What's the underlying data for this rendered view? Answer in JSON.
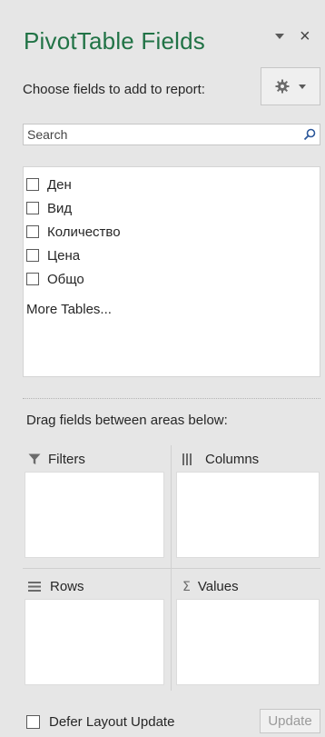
{
  "panel": {
    "title": "PivotTable Fields",
    "close_glyph": "×",
    "choose_label": "Choose fields to add to report:",
    "tools_icon": "gear-icon"
  },
  "search": {
    "placeholder": "Search",
    "icon": "search-icon"
  },
  "fields": [
    {
      "label": "Ден",
      "checked": false
    },
    {
      "label": "Вид",
      "checked": false
    },
    {
      "label": "Количество",
      "checked": false
    },
    {
      "label": "Цена",
      "checked": false
    },
    {
      "label": "Общо",
      "checked": false
    }
  ],
  "more_tables": "More Tables...",
  "areas": {
    "instruction": "Drag fields between areas below:",
    "filters": {
      "label": "Filters",
      "icon": "filter-icon"
    },
    "columns": {
      "label": "Columns",
      "icon": "columns-icon"
    },
    "rows": {
      "label": "Rows",
      "icon": "rows-icon"
    },
    "values": {
      "label": "Values",
      "icon": "sigma-icon"
    }
  },
  "footer": {
    "defer_label": "Defer Layout Update",
    "defer_checked": false,
    "update_label": "Update"
  },
  "colors": {
    "title": "#217346",
    "background": "#e6e6e6",
    "text": "#262626",
    "disabled_text": "#9a9a9a"
  }
}
